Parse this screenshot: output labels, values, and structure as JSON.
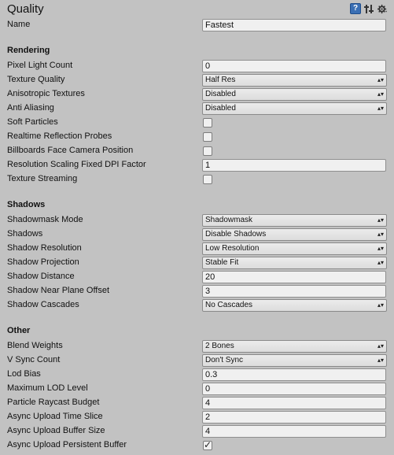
{
  "header": {
    "title": "Quality",
    "icons": [
      "help-icon",
      "preset-icon",
      "gear-icon"
    ]
  },
  "name": {
    "label": "Name",
    "value": "Fastest"
  },
  "rendering": {
    "title": "Rendering",
    "pixel_light_count": {
      "label": "Pixel Light Count",
      "value": "0"
    },
    "texture_quality": {
      "label": "Texture Quality",
      "value": "Half Res"
    },
    "anisotropic_textures": {
      "label": "Anisotropic Textures",
      "value": "Disabled"
    },
    "anti_aliasing": {
      "label": "Anti Aliasing",
      "value": "Disabled"
    },
    "soft_particles": {
      "label": "Soft Particles",
      "checked": false
    },
    "realtime_reflection_probes": {
      "label": "Realtime Reflection Probes",
      "checked": false
    },
    "billboards_face_camera": {
      "label": "Billboards Face Camera Position",
      "checked": false
    },
    "resolution_scaling": {
      "label": "Resolution Scaling Fixed DPI Factor",
      "value": "1"
    },
    "texture_streaming": {
      "label": "Texture Streaming",
      "checked": false
    }
  },
  "shadows": {
    "title": "Shadows",
    "shadowmask_mode": {
      "label": "Shadowmask Mode",
      "value": "Shadowmask"
    },
    "shadows": {
      "label": "Shadows",
      "value": "Disable Shadows"
    },
    "shadow_resolution": {
      "label": "Shadow Resolution",
      "value": "Low Resolution"
    },
    "shadow_projection": {
      "label": "Shadow Projection",
      "value": "Stable Fit"
    },
    "shadow_distance": {
      "label": "Shadow Distance",
      "value": "20"
    },
    "shadow_near_plane_offset": {
      "label": "Shadow Near Plane Offset",
      "value": "3"
    },
    "shadow_cascades": {
      "label": "Shadow Cascades",
      "value": "No Cascades"
    }
  },
  "other": {
    "title": "Other",
    "blend_weights": {
      "label": "Blend Weights",
      "value": "2 Bones"
    },
    "v_sync_count": {
      "label": "V Sync Count",
      "value": "Don't Sync"
    },
    "lod_bias": {
      "label": "Lod Bias",
      "value": "0.3"
    },
    "maximum_lod_level": {
      "label": "Maximum LOD Level",
      "value": "0"
    },
    "particle_raycast_budget": {
      "label": "Particle Raycast Budget",
      "value": "4"
    },
    "async_upload_time_slice": {
      "label": "Async Upload Time Slice",
      "value": "2"
    },
    "async_upload_buffer_size": {
      "label": "Async Upload Buffer Size",
      "value": "4"
    },
    "async_upload_persistent_buffer": {
      "label": "Async Upload Persistent Buffer",
      "checked": true
    }
  }
}
